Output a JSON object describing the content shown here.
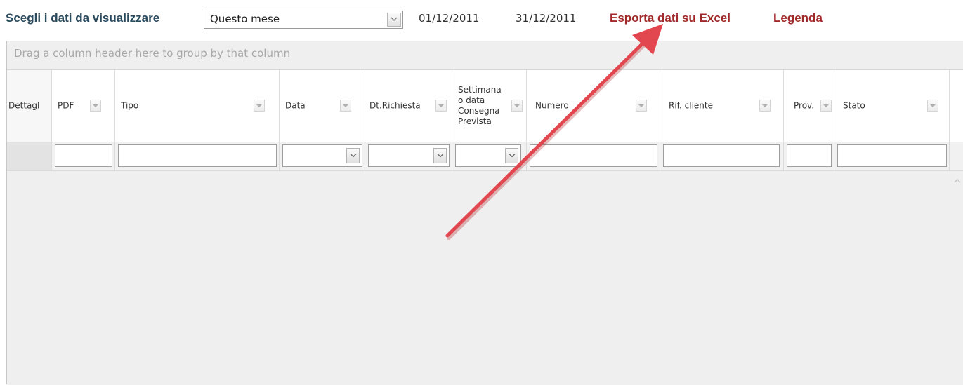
{
  "toolbar": {
    "label": "Scegli i dati da visualizzare",
    "period_value": "Questo mese",
    "date_from": "01/12/2011",
    "date_to": "31/12/2011",
    "export_label": "Esporta dati su Excel",
    "legend_label": "Legenda"
  },
  "grid": {
    "group_hint": "Drag a column header here to group by that column",
    "columns": [
      {
        "label": "Dettagl"
      },
      {
        "label": "PDF"
      },
      {
        "label": "Tipo"
      },
      {
        "label": "Data"
      },
      {
        "label": "Dt.Richiesta"
      },
      {
        "label": "Settimana\no data\nConsegna\nPrevista"
      },
      {
        "label": "Numero"
      },
      {
        "label": "Rif. cliente"
      },
      {
        "label": "Prov."
      },
      {
        "label": "Stato"
      }
    ]
  },
  "colors": {
    "title": "#2a4a5e",
    "link": "#a02a2a",
    "annotation_arrow": "#e2474f"
  },
  "icons": {
    "dropdown": "chevron-down-icon",
    "filter": "filter-menu-icon",
    "scroll_up": "scroll-up-icon",
    "annotation": "annotation-arrow-icon"
  }
}
